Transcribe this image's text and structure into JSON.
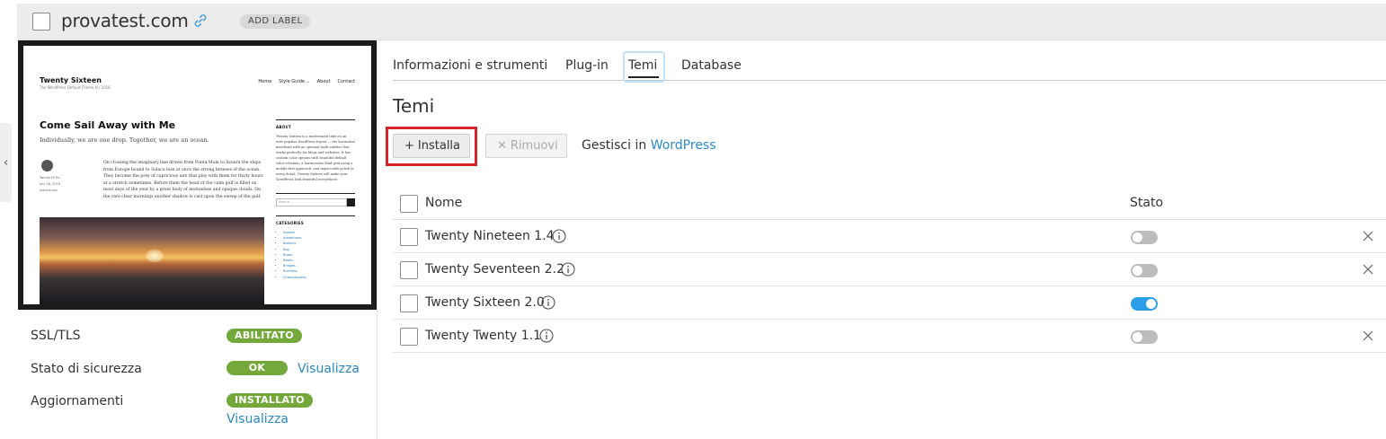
{
  "header": {
    "site_name": "provatest.com",
    "add_label": "ADD LABEL"
  },
  "preview": {
    "site_title": "Twenty Sixteen",
    "tagline": "The WordPress Default Theme for 2016",
    "nav": [
      "Home",
      "Style Guide ⌄",
      "About",
      "Contact"
    ],
    "post_title": "Come Sail Away with Me",
    "excerpt": "Individually, we are one drop. Together, we are an ocean.",
    "meta": "Twenty16 Fix\nJuly 18, 2016\nAdventures",
    "body": "On crossing the imaginary line drawn from Punta Mala to Azuera the ships from Europe bound to Sulaco lose at once the strong breezes of the ocean. They become the prey of capricious airs that play with them for thirty hours at a stretch sometimes. Before them the head of the calm gulf is filled on most days of the year by a great body of motionless and opaque clouds. On the rare clear mornings another shadow is cast upon the sweep of the gulf.",
    "sidebar_about_head": "ABOUT",
    "sidebar_about_text": "Twenty Sixteen is a modernized take on an ever-popular WordPress layout — the horizontal masthead with an optional right sidebar that works perfectly for blogs and websites. It has custom color options with beautiful default color schemes, a harmonious fluid grid using a mobile-first approach, and impeccable polish in every detail. Twenty Sixteen will make your WordPress look beautiful everywhere.",
    "search_placeholder": "Search ...",
    "categories_head": "CATEGORIES",
    "categories": [
      "Abroad",
      "Adventures",
      "Balance",
      "Bay",
      "Boats",
      "Books",
      "Bridges",
      "Business",
      "Championship"
    ]
  },
  "info": {
    "ssl_label": "SSL/TLS",
    "ssl_badge": "ABILITATO",
    "security_label": "Stato di sicurezza",
    "security_badge": "OK",
    "security_link": "Visualizza",
    "updates_label": "Aggiornamenti",
    "updates_badge": "INSTALLATO",
    "updates_link": "Visualizza"
  },
  "tabs": [
    {
      "label": "Informazioni e strumenti"
    },
    {
      "label": "Plug-in"
    },
    {
      "label": "Temi",
      "active": true
    },
    {
      "label": "Database"
    }
  ],
  "section_title": "Temi",
  "toolbar": {
    "install_label": "Installa",
    "remove_label": "Rimuovi",
    "manage_prefix": "Gestisci in",
    "manage_link": "WordPress"
  },
  "table": {
    "col_name": "Nome",
    "col_state": "Stato",
    "rows": [
      {
        "name": "Twenty Nineteen 1.4",
        "active": false,
        "removable": true
      },
      {
        "name": "Twenty Seventeen 2.2",
        "active": false,
        "removable": true
      },
      {
        "name": "Twenty Sixteen 2.0",
        "active": true,
        "removable": false
      },
      {
        "name": "Twenty Twenty 1.1",
        "active": false,
        "removable": true
      }
    ]
  },
  "colors": {
    "accent_link": "#2a8ac4",
    "badge_green": "#74a83b",
    "toggle_on": "#2a9ee6",
    "highlight_red": "#d5242a"
  }
}
